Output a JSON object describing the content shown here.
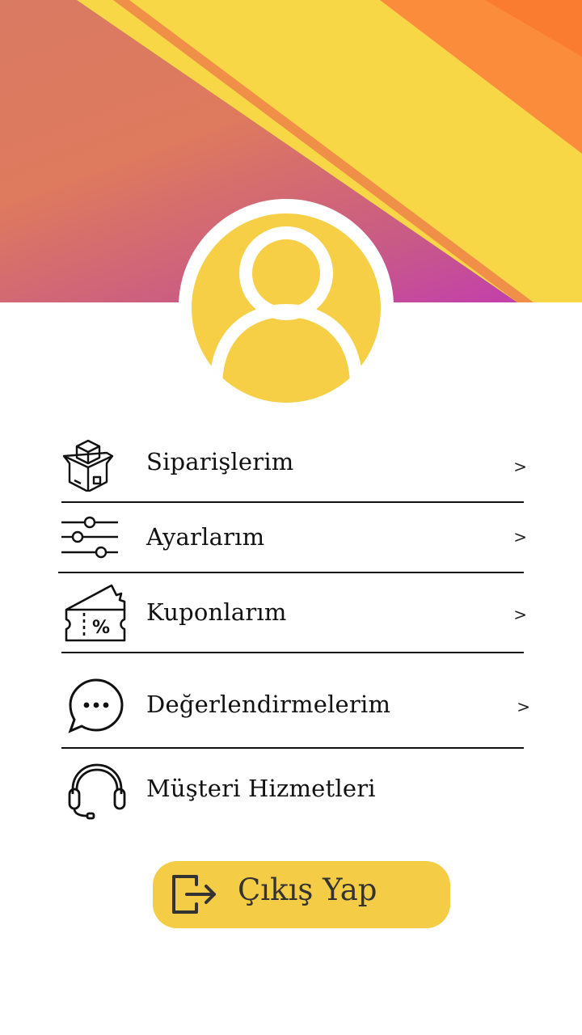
{
  "colors": {
    "accent": "#f5cc45",
    "header_orange": "#fb8c3c",
    "header_magenta": "#c23ab4"
  },
  "profile": {
    "avatar_icon": "user-avatar-icon"
  },
  "menu": {
    "items": [
      {
        "label": "Siparişlerim",
        "icon": "package-box-icon",
        "chevron": ">"
      },
      {
        "label": "Ayarlarım",
        "icon": "sliders-icon",
        "chevron": ">"
      },
      {
        "label": "Kuponlarım",
        "icon": "coupon-ticket-icon",
        "chevron": ">"
      },
      {
        "label": "Değerlendirmelerim",
        "icon": "chat-bubble-icon",
        "chevron": ">"
      },
      {
        "label": "Müşteri Hizmetleri",
        "icon": "headset-icon"
      }
    ]
  },
  "logout": {
    "label": "Çıkış Yap",
    "icon": "logout-icon"
  }
}
